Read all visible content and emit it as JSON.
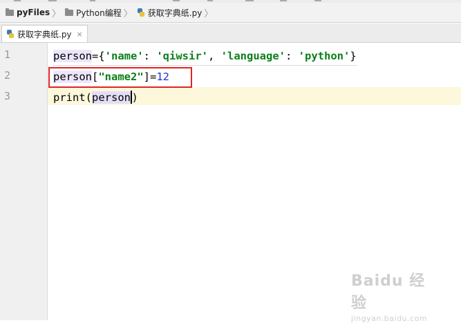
{
  "breadcrumb": {
    "items": [
      {
        "label": "pyFiles",
        "icon": "folder-icon"
      },
      {
        "label": "Python编程",
        "icon": "folder-icon"
      },
      {
        "label": "获取字典纸.py",
        "icon": "python-file-icon"
      }
    ]
  },
  "tabs": [
    {
      "label": "获取字典纸.py",
      "icon": "python-file-icon",
      "close": "×"
    }
  ],
  "editor": {
    "line_numbers": [
      "1",
      "2",
      "3"
    ],
    "lines": [
      [
        "person",
        "={",
        "'name'",
        ": ",
        "'qiwsir'",
        ", ",
        "'language'",
        ": ",
        "'python'",
        "}"
      ],
      [
        "person",
        "[",
        "\"name2\"",
        "]=",
        "12"
      ],
      [
        "print(",
        "person",
        ")"
      ]
    ]
  },
  "watermark": {
    "main": "Baidu 经验",
    "sub": "jingyan.baidu.com"
  },
  "colors": {
    "string": "#0b7f1a",
    "number": "#1a33d8",
    "highlight_box": "#e02424",
    "current_line": "#fdf8dc"
  }
}
